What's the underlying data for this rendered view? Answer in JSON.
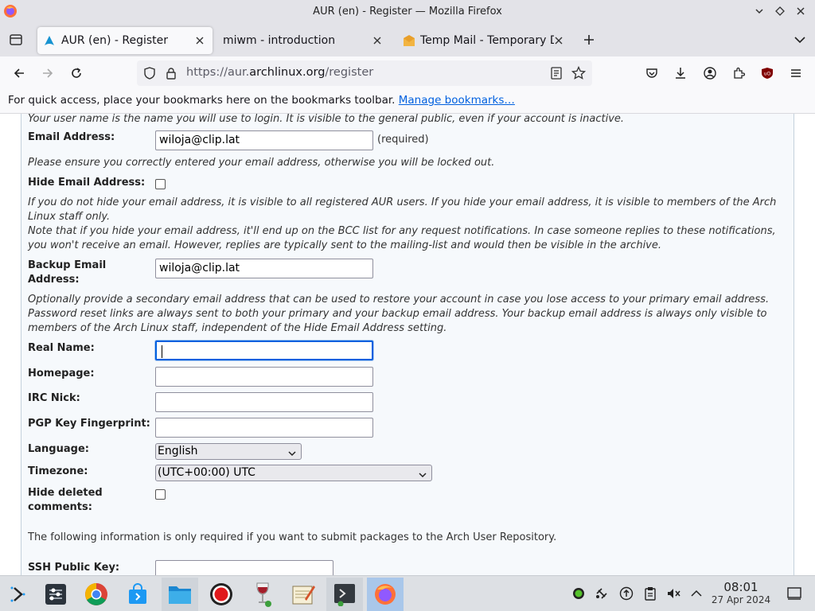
{
  "window": {
    "title": "AUR (en) - Register — Mozilla Firefox"
  },
  "tabs": [
    {
      "label": "AUR (en) - Register",
      "active": true
    },
    {
      "label": "miwm - introduction",
      "active": false
    },
    {
      "label": "Temp Mail - Temporary D",
      "active": false
    }
  ],
  "address_bar": {
    "prefix": "https://aur.",
    "domain": "archlinux.org",
    "path": "/register"
  },
  "bookmarks_bar": {
    "message": "For quick access, place your bookmarks here on the bookmarks toolbar.",
    "link": "Manage bookmarks…"
  },
  "form": {
    "username_help": "Your user name is the name you will use to login. It is visible to the general public, even if your account is inactive.",
    "email_label": "Email Address:",
    "email_value": "wiloja@clip.lat",
    "required": "(required)",
    "email_help": "Please ensure you correctly entered your email address, otherwise you will be locked out.",
    "hide_email_label": "Hide Email Address:",
    "hide_email_checked": false,
    "hide_email_help": [
      "If you do not hide your email address, it is visible to all registered AUR users. If you hide your email address, it is visible to members of the Arch",
      "Linux staff only.",
      "Note that if you hide your email address, it'll end up on the BCC list for any request notifications. In case someone replies to these notifications,",
      "you won't receive an email. However, replies are typically sent to the mailing-list and would then be visible in the archive."
    ],
    "backup_email_label_1": "Backup Email",
    "backup_email_label_2": "Address:",
    "backup_email_value": "wiloja@clip.lat",
    "backup_email_help": [
      "Optionally provide a secondary email address that can be used to restore your account in case you lose access to your primary email address.",
      "Password reset links are always sent to both your primary and your backup email address. Your backup email address is always only visible to",
      "members of the Arch Linux staff, independent of the Hide Email Address setting."
    ],
    "real_name_label": "Real Name:",
    "real_name_value": "",
    "homepage_label": "Homepage:",
    "homepage_value": "",
    "irc_label": "IRC Nick:",
    "irc_value": "",
    "pgp_label": "PGP Key Fingerprint:",
    "pgp_value": "",
    "language_label": "Language:",
    "language_value": "English",
    "timezone_label": "Timezone:",
    "timezone_value": "(UTC+00:00) UTC",
    "hide_deleted_label_1": "Hide deleted",
    "hide_deleted_label_2": "comments:",
    "hide_deleted_checked": false,
    "packager_info": "The following information is only required if you want to submit packages to the Arch User Repository.",
    "ssh_label": "SSH Public Key:"
  },
  "taskbar": {
    "apps": [
      "launcher",
      "system-settings",
      "chromium",
      "discover",
      "file-manager",
      "screen-recorder",
      "wine",
      "text-editor",
      "terminal",
      "firefox"
    ],
    "clock": {
      "time": "08:01",
      "date": "27 Apr 2024"
    }
  },
  "colors": {
    "accent": "#0060df",
    "taskbar_active": "#a9c7ea",
    "link": "#0060df"
  }
}
